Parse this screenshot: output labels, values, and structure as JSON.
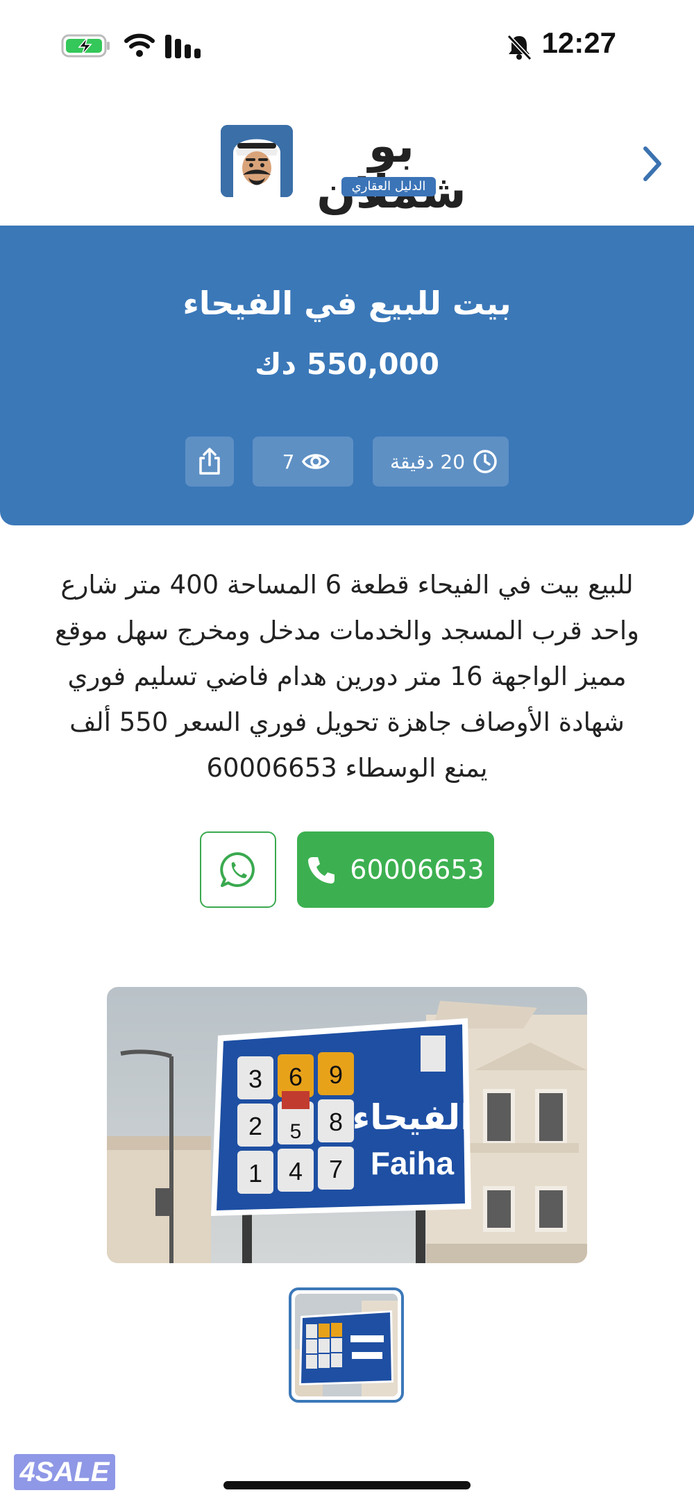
{
  "status_bar": {
    "time": "12:27"
  },
  "header": {
    "logo_name": "بو شملان",
    "logo_tagline": "الدليل العقاري"
  },
  "listing": {
    "title": "بيت للبيع في الفيحاء",
    "price": "550,000 دك",
    "posted_ago": "20 دقيقة",
    "views": "7",
    "description_lines": [
      "للبيع بيت في الفيحاء قطعة 6 المساحة 400 متر شارع",
      "واحد قرب المسجد والخدمات مدخل ومخرج سهل موقع",
      "مميز الواجهة 16 متر دورين هدام فاضي تسليم فوري",
      "شهادة الأوصاف جاهزة تحويل فوري السعر 550 ألف",
      "يمنع الوسطاء 60006653"
    ],
    "phone": "60006653"
  },
  "photo": {
    "sign_numbers": [
      "3",
      "6",
      "9",
      "2",
      "5",
      "8",
      "1",
      "4",
      "7"
    ],
    "sign_arabic": "الفيحاء",
    "sign_latin": "Faiha"
  },
  "watermark": "4SALE",
  "colors": {
    "accent": "#3b78b8",
    "whatsapp": "#3aa94f",
    "call": "#3cb050"
  }
}
